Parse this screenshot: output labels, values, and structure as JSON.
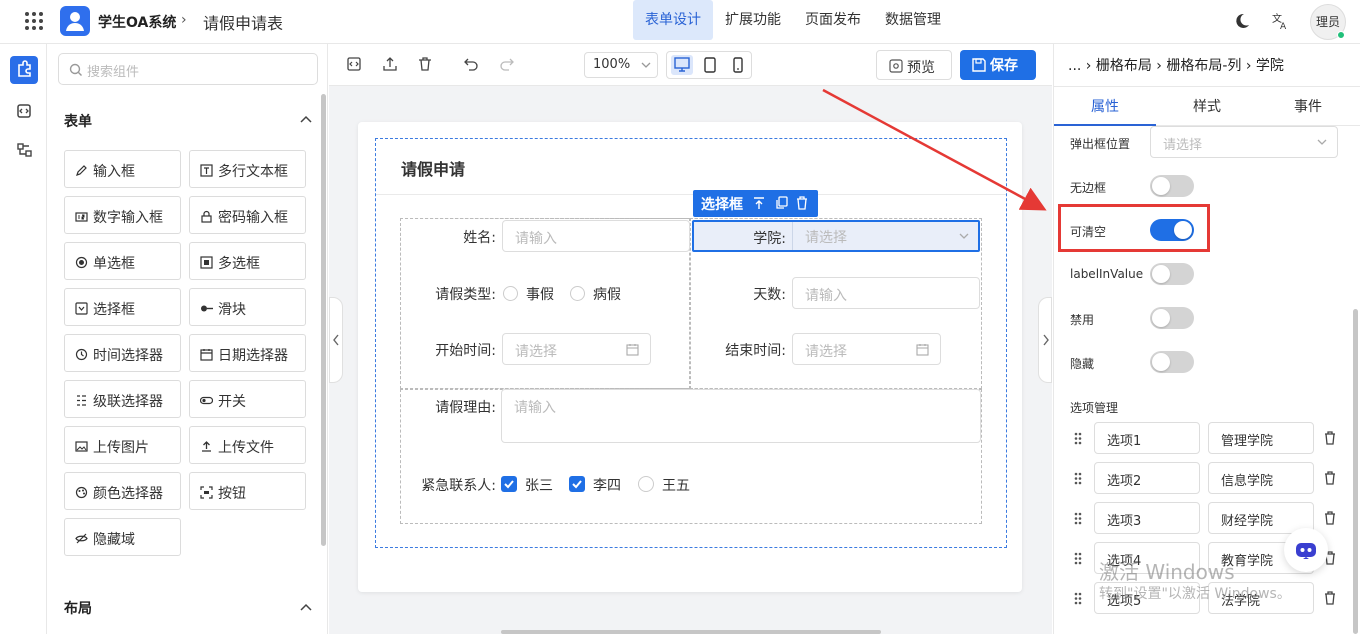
{
  "app": {
    "title": "学生OA系统",
    "page_title": "请假申请表",
    "user": "理员"
  },
  "nav": [
    {
      "label": "表单设计",
      "active": true
    },
    {
      "label": "扩展功能"
    },
    {
      "label": "页面发布"
    },
    {
      "label": "数据管理"
    }
  ],
  "components": {
    "search_placeholder": "搜索组件",
    "form_section": "表单",
    "layout_section": "布局",
    "items": [
      "输入框",
      "多行文本框",
      "数字输入框",
      "密码输入框",
      "单选框",
      "多选框",
      "选择框",
      "滑块",
      "时间选择器",
      "日期选择器",
      "级联选择器",
      "开关",
      "上传图片",
      "上传文件",
      "颜色选择器",
      "按钮",
      "隐藏域"
    ]
  },
  "toolbar": {
    "zoom": "100%",
    "preview": "预览",
    "save": "保存"
  },
  "form": {
    "title": "请假申请",
    "selected_tag": "选择框",
    "name_label": "姓名:",
    "name_ph": "请输入",
    "college_label": "学院:",
    "college_ph": "请选择",
    "type_label": "请假类型:",
    "type_opts": [
      "事假",
      "病假"
    ],
    "days_label": "天数:",
    "days_ph": "请输入",
    "start_label": "开始时间:",
    "start_ph": "请选择",
    "end_label": "结束时间:",
    "end_ph": "请选择",
    "reason_label": "请假理由:",
    "reason_ph": "请输入",
    "contact_label": "紧急联系人:",
    "contacts": [
      {
        "label": "张三",
        "checked": true
      },
      {
        "label": "李四",
        "checked": true
      },
      {
        "label": "王五",
        "checked": false
      }
    ]
  },
  "props": {
    "breadcrumb": "... › 栅格布局 › 栅格布局-列 › 学院",
    "tabs": [
      "属性",
      "样式",
      "事件"
    ],
    "popup_label": "弹出框位置",
    "popup_ph": "请选择",
    "toggles": [
      {
        "label": "无边框",
        "on": false
      },
      {
        "label": "可清空",
        "on": true
      },
      {
        "label": "labelInValue",
        "on": false
      },
      {
        "label": "禁用",
        "on": false
      },
      {
        "label": "隐藏",
        "on": false
      }
    ],
    "options_title": "选项管理",
    "options": [
      {
        "key": "选项1",
        "value": "管理学院"
      },
      {
        "key": "选项2",
        "value": "信息学院"
      },
      {
        "key": "选项3",
        "value": "财经学院"
      },
      {
        "key": "选项4",
        "value": "教育学院"
      },
      {
        "key": "选项5",
        "value": "法学院"
      }
    ]
  },
  "watermark": {
    "line1": "激活 Windows",
    "line2": "转到\"设置\"以激活 Windows。"
  },
  "colors": {
    "primary": "#1f6fe5",
    "highlight": "#e53935",
    "nav_active_bg": "#dce8fb"
  }
}
